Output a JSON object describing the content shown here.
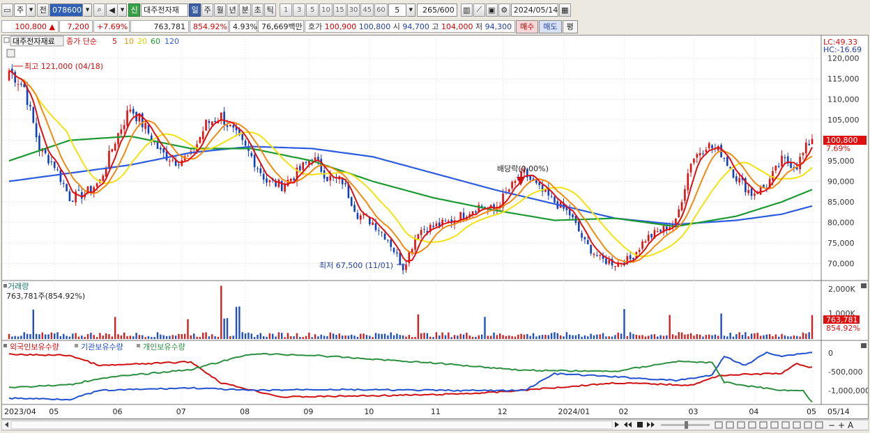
{
  "toolbar": {
    "market_label": "주",
    "prev_label": "전",
    "code": "078600",
    "sound_icon": "speaker-icon",
    "credit_badge": "신",
    "stock_name": "대주전자재",
    "periods": [
      "일",
      "주",
      "월",
      "년",
      "분",
      "초",
      "틱"
    ],
    "active_period": "일",
    "minute_steps": [
      "1",
      "3",
      "5",
      "10",
      "15",
      "30",
      "45",
      "60"
    ],
    "step_value": "5",
    "count": "265",
    "count_total": "/600",
    "date": "2024/05/14"
  },
  "quote": {
    "price": "100,800",
    "change": "7,200",
    "change_pct": "+7.69%",
    "volume": "763,781",
    "volume_ratio": "854.92%",
    "turnover": "4.93%",
    "amount": "76,669백만",
    "ask_label": "호가",
    "ask": "100,900",
    "bid": "100,800",
    "open_label": "시",
    "open": "94,700",
    "high_label": "고",
    "high": "104,000",
    "low_label": "저",
    "low": "94,300",
    "buy_label": "매수",
    "sell_label": "매도",
    "avg_label": "평"
  },
  "chart_data": {
    "type": "line",
    "title": "대주전자재료",
    "legend": [
      "종가 단순",
      "5",
      "10",
      "20",
      "60",
      "120"
    ],
    "colors": {
      "candle_up": "#e01010",
      "candle_down": "#1040c0",
      "ma5": "#e01010",
      "ma10": "#f08a10",
      "ma20": "#f4e20e",
      "ma60": "#1a9a30",
      "ma120": "#2a5be0",
      "volume_up": "#d02020",
      "volume_down": "#2050c0"
    },
    "y_ticks": [
      "120,000",
      "115,000",
      "110,000",
      "105,000",
      "100,000",
      "95,000",
      "90,000",
      "85,000",
      "80,000",
      "75,000",
      "70,000"
    ],
    "ylim": [
      66500,
      122500
    ],
    "x_labels": [
      "2023/04",
      "05",
      "06",
      "07",
      "08",
      "09",
      "10",
      "11",
      "12",
      "2024/01",
      "02",
      "03",
      "04",
      "05",
      "05/14"
    ],
    "annotations": {
      "high": "최고 121,000 (04/18)",
      "low": "최저 67,500 (11/01)",
      "dividend": "배당락(0.00%)"
    },
    "lc": "LC:49.33",
    "hc": "HC:-16.69",
    "current_price_label": "100,800",
    "current_pct_label": "7.69%",
    "volume_panel": {
      "title": "거래량",
      "info": "763,781주(854.92%)",
      "y_ticks": [
        "2,000K",
        "1,000K"
      ],
      "current_label": "763,781",
      "current_pct": "854.92%"
    },
    "holdings_panel": {
      "legend": [
        "외국인보유수량",
        "기관보유수량",
        "개인보유수량"
      ],
      "y_ticks": [
        "0",
        "-500,000",
        "-1,000,000"
      ],
      "colors": [
        "#d01010",
        "#2050d0",
        "#2a9040"
      ]
    },
    "series": [
      {
        "name": "ma120",
        "x": [
          0,
          20,
          40,
          60,
          80,
          100,
          120,
          140,
          160,
          180,
          200,
          220,
          240,
          255,
          265
        ],
        "values": [
          90000,
          92000,
          94000,
          97000,
          98500,
          98000,
          96000,
          92000,
          88000,
          84500,
          81000,
          79500,
          80500,
          82000,
          84000
        ]
      },
      {
        "name": "ma60",
        "x": [
          0,
          20,
          40,
          60,
          80,
          100,
          120,
          140,
          160,
          180,
          200,
          220,
          240,
          255,
          265
        ],
        "values": [
          95000,
          100000,
          101000,
          98000,
          98000,
          95000,
          90000,
          86000,
          83000,
          80500,
          81000,
          79000,
          81500,
          85000,
          88000
        ]
      },
      {
        "name": "close",
        "x": [
          0,
          5,
          10,
          15,
          20,
          25,
          30,
          35,
          40,
          45,
          50,
          55,
          60,
          65,
          70,
          75,
          80,
          85,
          90,
          95,
          100,
          105,
          110,
          115,
          120,
          125,
          130,
          135,
          140,
          145,
          150,
          155,
          160,
          165,
          170,
          175,
          180,
          185,
          190,
          195,
          200,
          205,
          210,
          215,
          220,
          225,
          230,
          235,
          240,
          245,
          250,
          255,
          260,
          265
        ],
        "values": [
          117000,
          113000,
          98000,
          94000,
          86000,
          87000,
          90000,
          100000,
          108000,
          103000,
          97000,
          95000,
          96000,
          104000,
          106000,
          101000,
          96000,
          90000,
          89000,
          92000,
          96000,
          91000,
          90000,
          82000,
          80000,
          76000,
          69000,
          78000,
          79000,
          80000,
          82000,
          84000,
          83000,
          88000,
          92000,
          88000,
          85000,
          82000,
          75000,
          71000,
          70000,
          71000,
          76000,
          78000,
          80000,
          95000,
          99000,
          97000,
          91000,
          87000,
          89000,
          95000,
          94000,
          100800
        ]
      }
    ]
  },
  "scrollbar": {
    "left_icon": "scroll-left-icon",
    "buttons": [
      "play-icon",
      "rewind-icon",
      "stop-icon",
      "fast-forward-icon"
    ],
    "zoom": [
      "−",
      "+",
      "A"
    ]
  }
}
